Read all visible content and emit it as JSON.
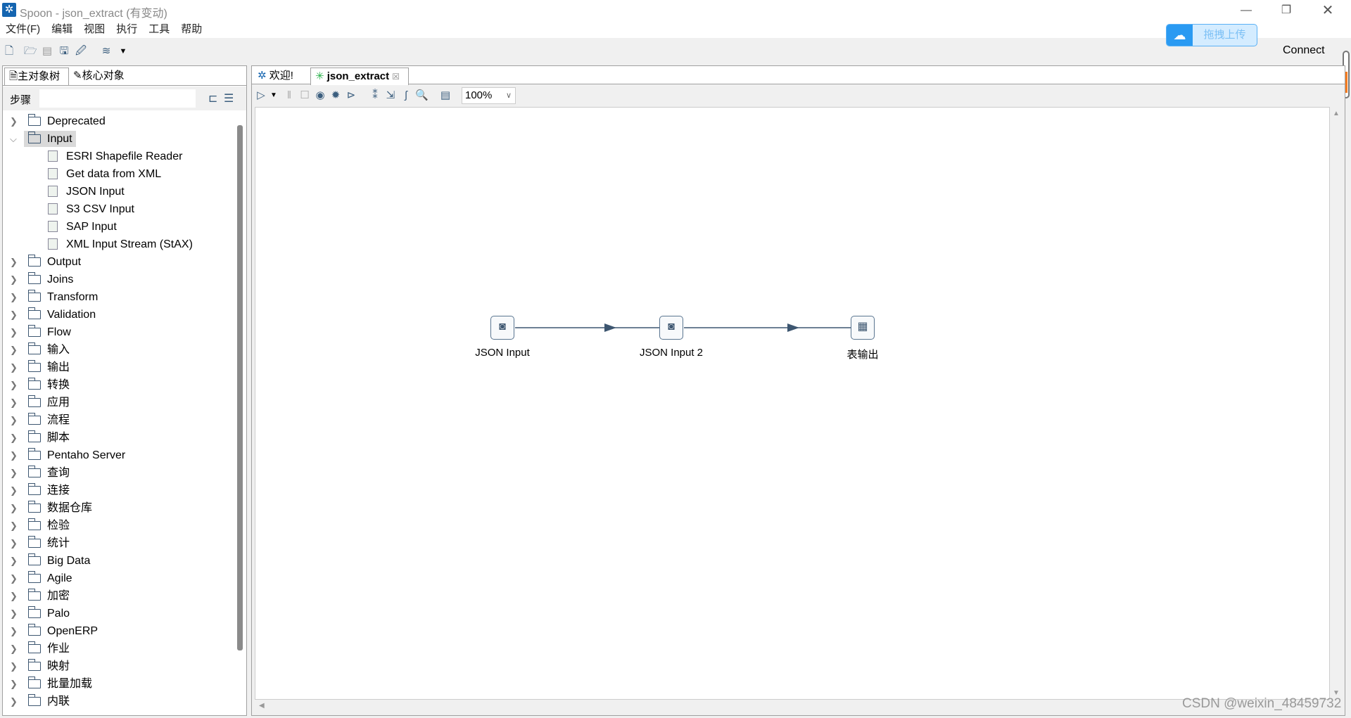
{
  "window": {
    "title": "Spoon - json_extract (有变动)",
    "controls": [
      "minimize",
      "restore",
      "close"
    ]
  },
  "menu": [
    "文件(F)",
    "编辑",
    "视图",
    "执行",
    "工具",
    "帮助"
  ],
  "toolbar": {
    "icons": [
      "new-file-icon",
      "open-file-icon",
      "explore-repo-icon",
      "save-icon",
      "save-as-icon",
      "layers-icon"
    ]
  },
  "upload_button": {
    "label": "拖拽上传",
    "icon": "cloud-icon",
    "color": "#2a9af2"
  },
  "connect_label": "Connect",
  "left_panel": {
    "tabs": [
      "主对象树",
      "核心对象"
    ],
    "search_label": "步骤",
    "search_value": "",
    "tree": [
      {
        "label": "Deprecated",
        "expanded": false
      },
      {
        "label": "Input",
        "expanded": true,
        "selected": true,
        "children": [
          "ESRI Shapefile Reader",
          "Get data from XML",
          "JSON Input",
          "S3 CSV Input",
          "SAP Input",
          "XML Input Stream (StAX)"
        ]
      },
      {
        "label": "Output"
      },
      {
        "label": "Joins"
      },
      {
        "label": "Transform"
      },
      {
        "label": "Validation"
      },
      {
        "label": "Flow"
      },
      {
        "label": "输入"
      },
      {
        "label": "输出"
      },
      {
        "label": "转换"
      },
      {
        "label": "应用"
      },
      {
        "label": "流程"
      },
      {
        "label": "脚本"
      },
      {
        "label": "Pentaho Server"
      },
      {
        "label": "查询"
      },
      {
        "label": "连接"
      },
      {
        "label": "数据仓库"
      },
      {
        "label": "检验"
      },
      {
        "label": "统计"
      },
      {
        "label": "Big Data"
      },
      {
        "label": "Agile"
      },
      {
        "label": "加密"
      },
      {
        "label": "Palo"
      },
      {
        "label": "OpenERP"
      },
      {
        "label": "作业"
      },
      {
        "label": "映射"
      },
      {
        "label": "批量加载"
      },
      {
        "label": "内联"
      }
    ]
  },
  "editor": {
    "tabs": [
      {
        "label": "欢迎!",
        "active": false
      },
      {
        "label": "json_extract",
        "active": true,
        "closable": true
      }
    ],
    "zoom": "100%",
    "steps": [
      {
        "name": "JSON Input",
        "type": "json-input"
      },
      {
        "name": "JSON Input 2",
        "type": "json-input"
      },
      {
        "name": "表输出",
        "type": "table-output"
      }
    ],
    "hops": [
      [
        "JSON Input",
        "JSON Input 2"
      ],
      [
        "JSON Input 2",
        "表输出"
      ]
    ]
  },
  "watermark": "CSDN @weixin_48459732"
}
